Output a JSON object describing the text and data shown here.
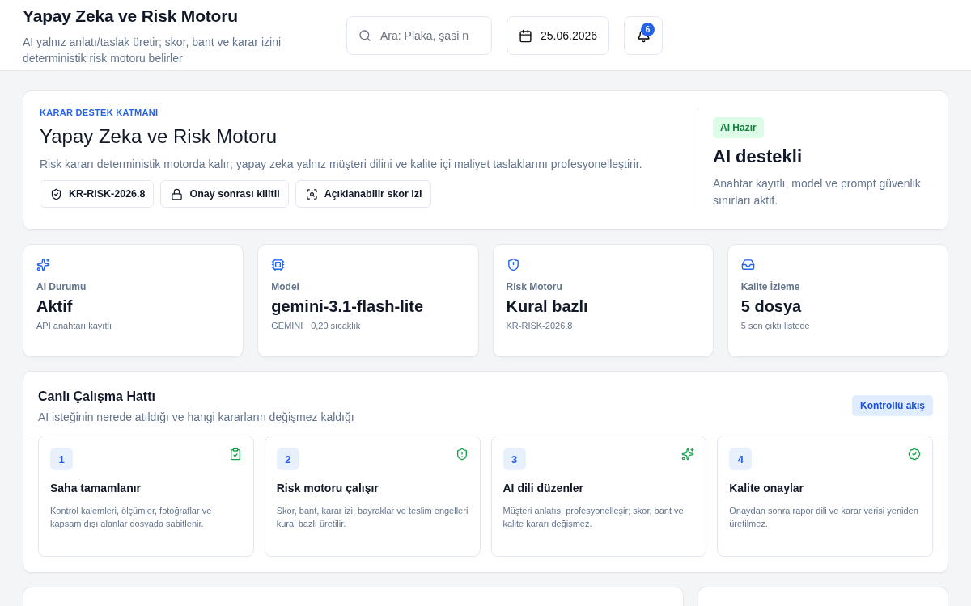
{
  "header": {
    "title": "Yapay Zeka ve Risk Motoru",
    "subtitle": "AI yalnız anlatı/taslak üretir; skor, bant ve karar izini deterministik risk motoru belirler",
    "search": {
      "placeholder": "Ara: Plaka, şasi n"
    },
    "date": "25.06.2026",
    "notifications": "6"
  },
  "hero": {
    "eyebrow": "KARAR DESTEK KATMANI",
    "title": "Yapay Zeka ve Risk Motoru",
    "description": "Risk kararı deterministik motorda kalır; yapay zeka yalnız müşteri dilini ve kalite içi maliyet taslaklarını profesyonelleştirir.",
    "chips": [
      "KR-RISK-2026.8",
      "Onay sonrası kilitli",
      "Açıklanabilir skor izi"
    ],
    "status": {
      "badge": "AI Hazır",
      "title": "AI destekli",
      "text": "Anahtar kayıtlı, model ve prompt güvenlik sınırları aktif."
    }
  },
  "stats": [
    {
      "label": "AI Durumu",
      "value": "Aktif",
      "note": "API anahtarı kayıtlı"
    },
    {
      "label": "Model",
      "value": "gemini-3.1-flash-lite",
      "note": "GEMINI · 0,20 sıcaklık"
    },
    {
      "label": "Risk Motoru",
      "value": "Kural bazlı",
      "note": "KR-RISK-2026.8"
    },
    {
      "label": "Kalite İzleme",
      "value": "5 dosya",
      "note": "5 son çıktı listede"
    }
  ],
  "pipeline": {
    "title": "Canlı Çalışma Hattı",
    "subtitle": "AI isteğinin nerede atıldığı ve hangi kararların değişmez kaldığı",
    "badge": "Kontrollü akış",
    "steps": [
      {
        "number": "1",
        "title": "Saha tamamlanır",
        "text": "Kontrol kalemleri, ölçümler, fotoğraflar ve kapsam dışı alanlar dosyada sabitlenir."
      },
      {
        "number": "2",
        "title": "Risk motoru çalışır",
        "text": "Skor, bant, karar izi, bayraklar ve teslim engelleri kural bazlı üretilir."
      },
      {
        "number": "3",
        "title": "AI dili düzenler",
        "text": "Müşteri anlatısı profesyonelleşir; skor, bant ve kalite kararı değişmez."
      },
      {
        "number": "4",
        "title": "Kalite onaylar",
        "text": "Onaydan sonra rapor dili ve karar verisi yeniden üretilmez."
      }
    ]
  }
}
